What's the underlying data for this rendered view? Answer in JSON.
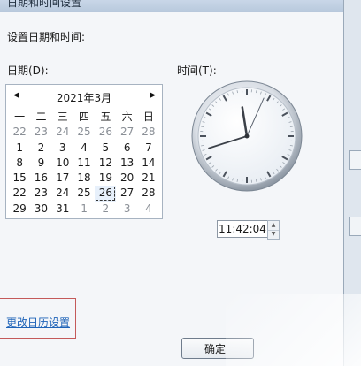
{
  "window": {
    "title": "日期和时间设置"
  },
  "heading": "设置日期和时间:",
  "date_label": "日期(D):",
  "time_label": "时间(T):",
  "calendar": {
    "prev": "◀",
    "next": "▶",
    "month_title": "2021年3月",
    "weekdays": [
      "一",
      "二",
      "三",
      "四",
      "五",
      "六",
      "日"
    ],
    "weeks": [
      [
        "22",
        "23",
        "24",
        "25",
        "26",
        "27",
        "28"
      ],
      [
        "1",
        "2",
        "3",
        "4",
        "5",
        "6",
        "7"
      ],
      [
        "8",
        "9",
        "10",
        "11",
        "12",
        "13",
        "14"
      ],
      [
        "15",
        "16",
        "17",
        "18",
        "19",
        "20",
        "21"
      ],
      [
        "22",
        "23",
        "24",
        "25",
        "26",
        "27",
        "28"
      ],
      [
        "29",
        "30",
        "31",
        "1",
        "2",
        "3",
        "4"
      ]
    ],
    "selected": "26"
  },
  "clock": {
    "hour": 11,
    "minute": 42,
    "second": 4
  },
  "time_value": "11:42:04",
  "calendar_link": "更改日历设置",
  "ok_button": "确定",
  "colors": {
    "link": "#1e63b8",
    "highlight_box": "#c45a5a"
  }
}
